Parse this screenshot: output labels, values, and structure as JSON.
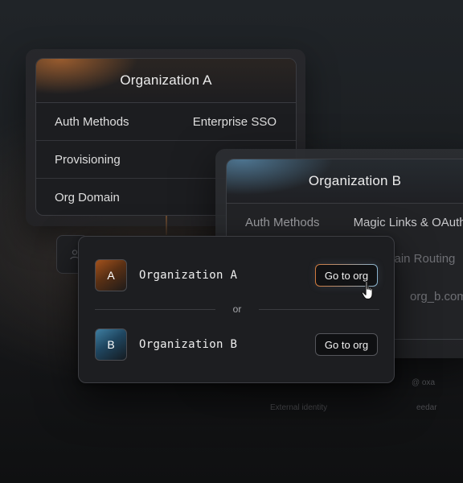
{
  "org_a_card": {
    "title": "Organization A",
    "rows": [
      {
        "label": "Auth Methods",
        "value": "Enterprise SSO"
      },
      {
        "label": "Provisioning",
        "value": ""
      },
      {
        "label": "Org Domain",
        "value": ""
      }
    ]
  },
  "org_b_card": {
    "title": "Organization B",
    "auth_label": "Auth Methods",
    "auth_value": "Magic Links & OAuth",
    "routing_fragment": "main Routing",
    "domain_fragment": "org_b.com",
    "faded_1": "@ oxa",
    "faded_2": "External identity",
    "faded_3": "eedar"
  },
  "switcher": {
    "orgs": [
      {
        "initial": "A",
        "name": "Organization A",
        "button": "Go to org",
        "accent": "#a4521c"
      },
      {
        "initial": "B",
        "name": "Organization B",
        "button": "Go to org",
        "accent": "#3f7fa2"
      }
    ],
    "separator": "or"
  },
  "icons": {
    "pointer": "hand-pointer-icon",
    "ghost": "user-icon"
  }
}
